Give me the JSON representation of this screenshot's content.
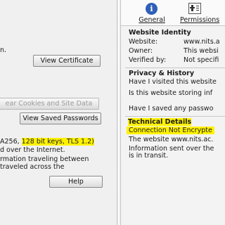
{
  "left_panel": {
    "line_partial_top": "n.",
    "view_certificate_label": "View Certificate",
    "clear_cookies_label": "ear Cookies and Site Data",
    "view_saved_passwords_label": "View Saved Passwords",
    "cipher_prefix": "A256, ",
    "cipher_highlight": "128 bit keys, TLS 1.2)",
    "encrypted_line": "d over the Internet.",
    "info_line1": "rmation traveling between",
    "info_line2": "traveled across the",
    "help_label": "Help"
  },
  "tabs": [
    {
      "label": "General",
      "icon": "info-icon"
    },
    {
      "label": "Permissions",
      "icon": "permissions-icon"
    }
  ],
  "identity": {
    "heading": "Website Identity",
    "website_label": "Website:",
    "website_value": "www.nits.a",
    "owner_label": "Owner:",
    "owner_value": "This websi",
    "verified_label": "Verified by:",
    "verified_value": "Not specifi"
  },
  "privacy": {
    "heading": "Privacy & History",
    "q1": "Have I visited this website",
    "q2": "Is this website storing inf",
    "q3": "Have I saved any passwo"
  },
  "technical": {
    "heading": "Technical Details",
    "status": "Connection Not Encrypte",
    "line1": "The website www.nits.ac.",
    "line2": "Information sent over the",
    "line3": "is in transit."
  },
  "colors": {
    "highlight": "#fff200",
    "info_icon_bg": "#2f5fb8"
  }
}
